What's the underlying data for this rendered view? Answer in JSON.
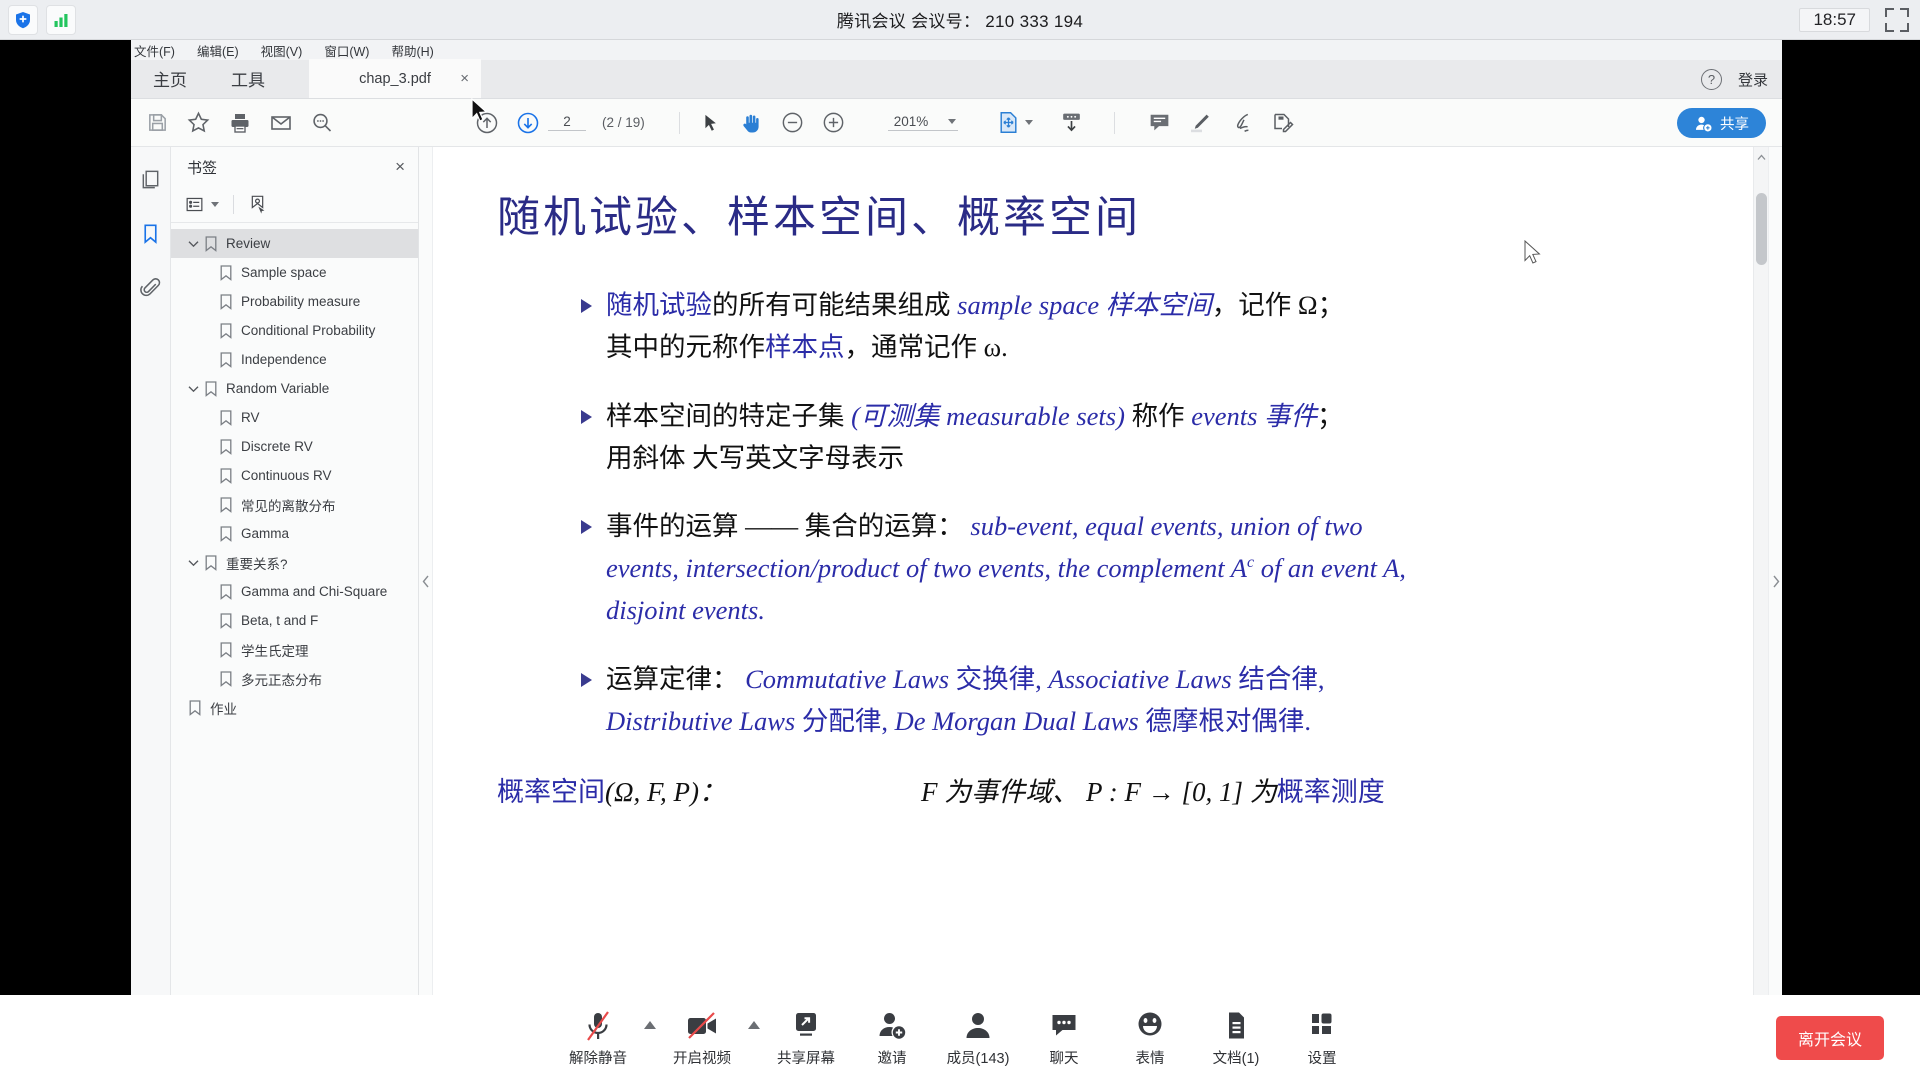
{
  "meeting": {
    "title": "腾讯会议 会议号： 210 333 194",
    "clock": "18:57",
    "shrink_icon": "shrink-icon",
    "tray_icons": [
      "shield-plus-icon",
      "signal-bars-icon"
    ],
    "leave_label": "离开会议",
    "actions": [
      {
        "label": "解除静音",
        "icon": "microphone-muted-icon",
        "caret": true
      },
      {
        "label": "开启视频",
        "icon": "camera-off-icon",
        "caret": true
      },
      {
        "label": "共享屏幕",
        "icon": "share-screen-icon",
        "caret": false
      },
      {
        "label": "邀请",
        "icon": "invite-person-icon",
        "caret": false
      },
      {
        "label": "成员(143)",
        "icon": "members-icon",
        "caret": false
      },
      {
        "label": "聊天",
        "icon": "chat-bubble-icon",
        "caret": false
      },
      {
        "label": "表情",
        "icon": "emoji-icon",
        "caret": false
      },
      {
        "label": "文档(1)",
        "icon": "document-icon",
        "caret": false
      },
      {
        "label": "设置",
        "icon": "settings-grid-icon",
        "caret": false
      }
    ]
  },
  "pdf": {
    "menubar": [
      "文件(F)",
      "编辑(E)",
      "视图(V)",
      "窗口(W)",
      "帮助(H)"
    ],
    "tabs": {
      "home": "主页",
      "tools": "工具",
      "document": "chap_3.pdf",
      "close": "×"
    },
    "help_glyph": "?",
    "login_label": "登录",
    "share_label": "共享",
    "toolbar": {
      "left_icons": [
        "save-icon",
        "star-icon",
        "print-icon",
        "email-icon",
        "search-icon"
      ],
      "page_up_icon": "page-up-icon",
      "page_down_icon": "page-down-icon",
      "page_value": "2",
      "page_count": "(2 / 19)",
      "select_icon": "select-arrow-icon",
      "hand_icon": "hand-tool-icon",
      "zoom_out_icon": "zoom-out-icon",
      "zoom_in_icon": "zoom-in-icon",
      "zoom_value": "201%",
      "fit_icon": "fit-page-icon",
      "scroll_mode_icon": "scroll-mode-icon",
      "comment_icon": "comment-icon",
      "highlight_icon": "highlight-pen-icon",
      "signature_icon": "signature-icon",
      "stamp_icon": "stamp-edit-icon"
    },
    "rail": [
      "pages-thumbnail-icon",
      "bookmark-icon",
      "attachment-icon"
    ],
    "bookmarks": {
      "title": "书签",
      "close": "×",
      "tools": [
        "bookmark-options-icon",
        "bookmark-locate-icon"
      ],
      "items": [
        {
          "label": "Review",
          "level": 0,
          "expandable": true,
          "selected": true
        },
        {
          "label": "Sample space",
          "level": 1,
          "expandable": false,
          "selected": false
        },
        {
          "label": "Probability measure",
          "level": 1,
          "expandable": false,
          "selected": false
        },
        {
          "label": "Conditional Probability",
          "level": 1,
          "expandable": false,
          "selected": false
        },
        {
          "label": "Independence",
          "level": 1,
          "expandable": false,
          "selected": false
        },
        {
          "label": "Random Variable",
          "level": 0,
          "expandable": true,
          "selected": false
        },
        {
          "label": "RV",
          "level": 1,
          "expandable": false,
          "selected": false
        },
        {
          "label": "Discrete RV",
          "level": 1,
          "expandable": false,
          "selected": false
        },
        {
          "label": "Continuous RV",
          "level": 1,
          "expandable": false,
          "selected": false
        },
        {
          "label": "常见的离散分布",
          "level": 1,
          "expandable": false,
          "selected": false
        },
        {
          "label": "Gamma",
          "level": 1,
          "expandable": false,
          "selected": false
        },
        {
          "label": "重要关系?",
          "level": 0,
          "expandable": true,
          "selected": false
        },
        {
          "label": "Gamma and Chi-Square",
          "level": 1,
          "expandable": false,
          "selected": false
        },
        {
          "label": "Beta, t and F",
          "level": 1,
          "expandable": false,
          "selected": false
        },
        {
          "label": "学生氏定理",
          "level": 1,
          "expandable": false,
          "selected": false
        },
        {
          "label": "多元正态分布",
          "level": 1,
          "expandable": false,
          "selected": false
        },
        {
          "label": "作业",
          "level": 0,
          "expandable": false,
          "selected": false
        }
      ]
    }
  },
  "slide": {
    "title": "随机试验、样本空间、概率空间",
    "bullets": [
      {
        "l1a": "随机试验",
        "l1b": "的所有可能结果组成 ",
        "l1c": "sample space 样本空间",
        "l1d": "，记作 Ω；",
        "l2a": "其中的元称作",
        "l2b": "样本点",
        "l2c": "，通常记作 ω."
      },
      {
        "l1a": "样本空间的特定子集 ",
        "l1b": "(可测集 measurable sets)",
        "l1c": " 称作 ",
        "l1d": "events 事件",
        "l1e": "；",
        "l2a": "用斜体 大写英文字母表示"
      },
      {
        "l1a": "事件的运算 —— 集合的运算：  ",
        "l1b": "sub-event, equal events, union of two events, intersection/product of two events, the complement A",
        "l1sup": "c",
        "l1c": " of an event A, disjoint events."
      },
      {
        "l1a": "运算定律：  ",
        "l1b": "Commutative Laws",
        "l1c": " 交换律, ",
        "l1d": "Associative Laws",
        "l1e": " 结合律,",
        "l2a": "Distributive Laws",
        "l2b": " 分配律, ",
        "l2c": "De Morgan Dual Laws",
        "l2d": " 德摩根对偶律."
      }
    ],
    "footer": {
      "left_blue": "概率空间",
      "left_black": " (Ω, F, P)：",
      "right": "F 为事件域、 P : F → [0, 1] 为 ",
      "right_blue": "概率测度"
    }
  },
  "colors": {
    "accent_blue": "#2d84d8",
    "slide_blue": "#2b2ca8",
    "leave_red": "#ef4b4b",
    "bookmark_sel": "#dedfe1"
  }
}
